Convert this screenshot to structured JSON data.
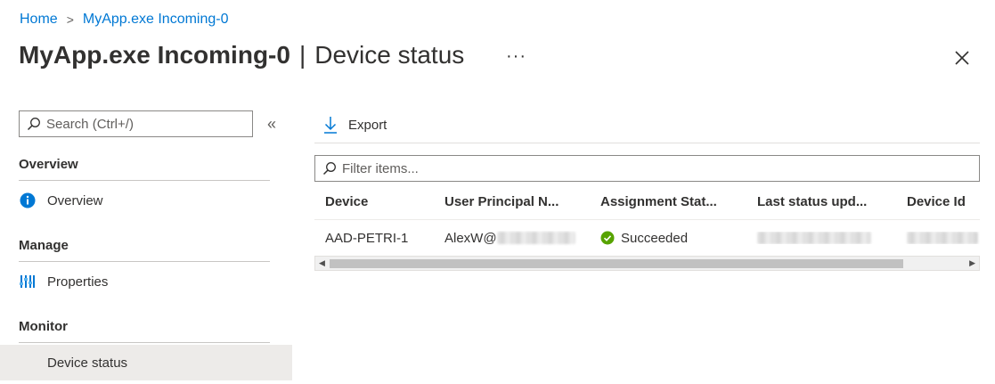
{
  "breadcrumb": {
    "home": "Home",
    "current": "MyApp.exe Incoming-0"
  },
  "header": {
    "title": "MyApp.exe Incoming-0",
    "separator": "|",
    "subtitle": "Device status",
    "more": "···"
  },
  "sidebar": {
    "search_placeholder": "Search (Ctrl+/)",
    "collapse": "«",
    "sections": [
      {
        "title": "Overview",
        "items": [
          {
            "label": "Overview",
            "icon": "info-icon"
          }
        ]
      },
      {
        "title": "Manage",
        "items": [
          {
            "label": "Properties",
            "icon": "properties-icon"
          }
        ]
      },
      {
        "title": "Monitor",
        "items": [
          {
            "label": "Device status",
            "icon": "",
            "active": true
          }
        ]
      }
    ]
  },
  "toolbar": {
    "export_label": "Export"
  },
  "filter": {
    "placeholder": "Filter items..."
  },
  "table": {
    "columns": [
      "Device",
      "User Principal N...",
      "Assignment Stat...",
      "Last status upd...",
      "Device Id"
    ],
    "rows": [
      {
        "device": "AAD-PETRI-1",
        "user": "AlexW@",
        "status": "Succeeded",
        "status_icon": "success-check-icon"
      }
    ]
  },
  "colors": {
    "accent": "#0078d4",
    "success": "#57a300",
    "active_bg": "#edebe9"
  }
}
